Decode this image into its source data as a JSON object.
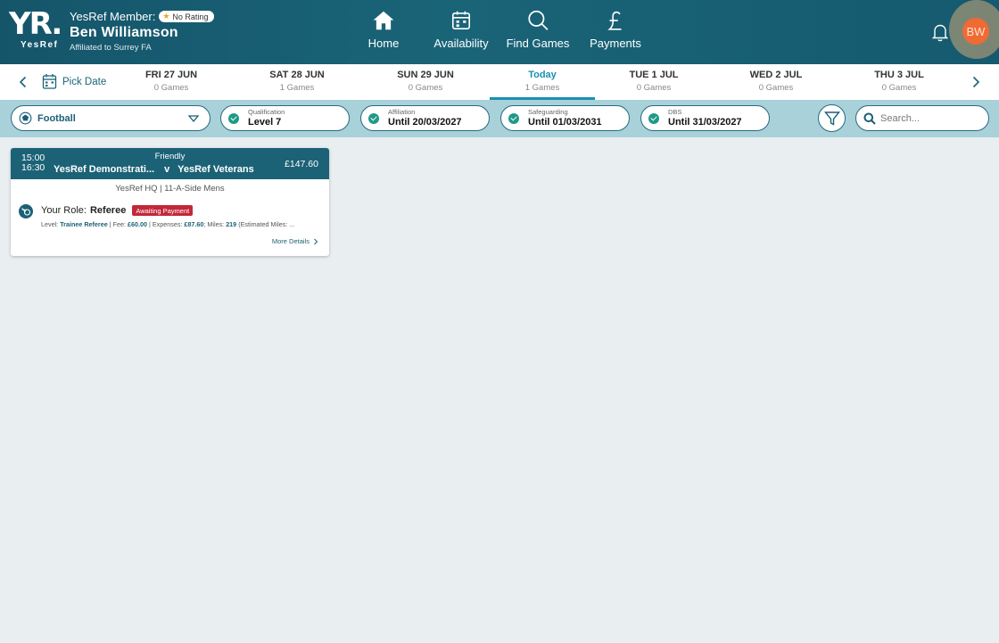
{
  "header": {
    "logo_text": "YR.",
    "logo_sub": "YesRef",
    "member_label": "YesRef Member:",
    "rating_label": "No Rating",
    "member_name": "Ben Williamson",
    "affiliation": "Affiliated to Surrey FA",
    "avatar_initials": "BW",
    "nav": [
      {
        "label": "Home",
        "icon": "home-icon"
      },
      {
        "label": "Availability",
        "icon": "calendar-icon"
      },
      {
        "label": "Find Games",
        "icon": "search-icon"
      },
      {
        "label": "Payments",
        "icon": "pound-icon"
      }
    ]
  },
  "datebar": {
    "pick_label": "Pick Date",
    "days": [
      {
        "date": "FRI 27 JUN",
        "games": "0 Games"
      },
      {
        "date": "SAT 28 JUN",
        "games": "1 Games"
      },
      {
        "date": "SUN 29 JUN",
        "games": "0 Games"
      },
      {
        "date": "Today",
        "games": "1 Games",
        "active": true
      },
      {
        "date": "TUE 1 JUL",
        "games": "0 Games"
      },
      {
        "date": "WED 2 JUL",
        "games": "0 Games"
      },
      {
        "date": "THU 3 JUL",
        "games": "0 Games"
      }
    ]
  },
  "filters": {
    "sport": "Football",
    "qualification": {
      "label": "Qualification",
      "value": "Level 7"
    },
    "affiliation": {
      "label": "Affiliation",
      "value": "Until 20/03/2027"
    },
    "safeguarding": {
      "label": "Safeguarding",
      "value": "Until 01/03/2031"
    },
    "dbs": {
      "label": "DBS",
      "value": "Until 31/03/2027"
    },
    "search_placeholder": "Search..."
  },
  "game": {
    "start": "15:00",
    "end": "16:30",
    "type": "Friendly",
    "home": "YesRef Demonstrati...",
    "vs": "v",
    "away": "YesRef Veterans",
    "price": "£147.60",
    "venue": "YesRef HQ | 11-A-Side Mens",
    "role_label": "Your Role:",
    "role": "Referee",
    "status": "Awaiting Payment",
    "level_label": "Level:",
    "level": "Trainee Referee",
    "fee_label": "Fee:",
    "fee": "£60.00",
    "expenses_label": "Expenses:",
    "expenses": "£87.60",
    "miles_label": "Miles:",
    "miles": "219",
    "estimated": "(Estimated Miles: ...",
    "more_label": "More Details"
  },
  "colors": {
    "header_bg": "#1a6478",
    "accent": "#1a8fb0",
    "filter_bar": "#a8d1da",
    "badge_red": "#c2283a",
    "avatar": "#ef6b34"
  }
}
